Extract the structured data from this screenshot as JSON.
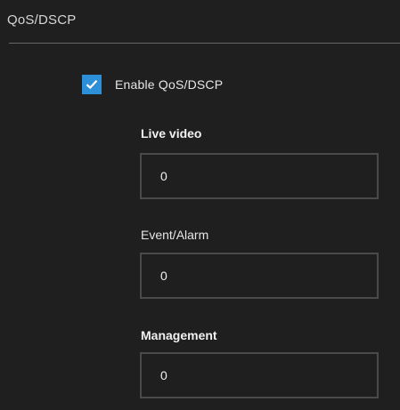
{
  "panel": {
    "title": "QoS/DSCP"
  },
  "enable": {
    "label": "Enable QoS/DSCP",
    "checked": true,
    "accent_color": "#2d8fd8"
  },
  "fields": {
    "live_video": {
      "label": "Live video",
      "value": "0"
    },
    "event_alarm": {
      "label": "Event/Alarm",
      "value": "0"
    },
    "management": {
      "label": "Management",
      "value": "0"
    }
  }
}
